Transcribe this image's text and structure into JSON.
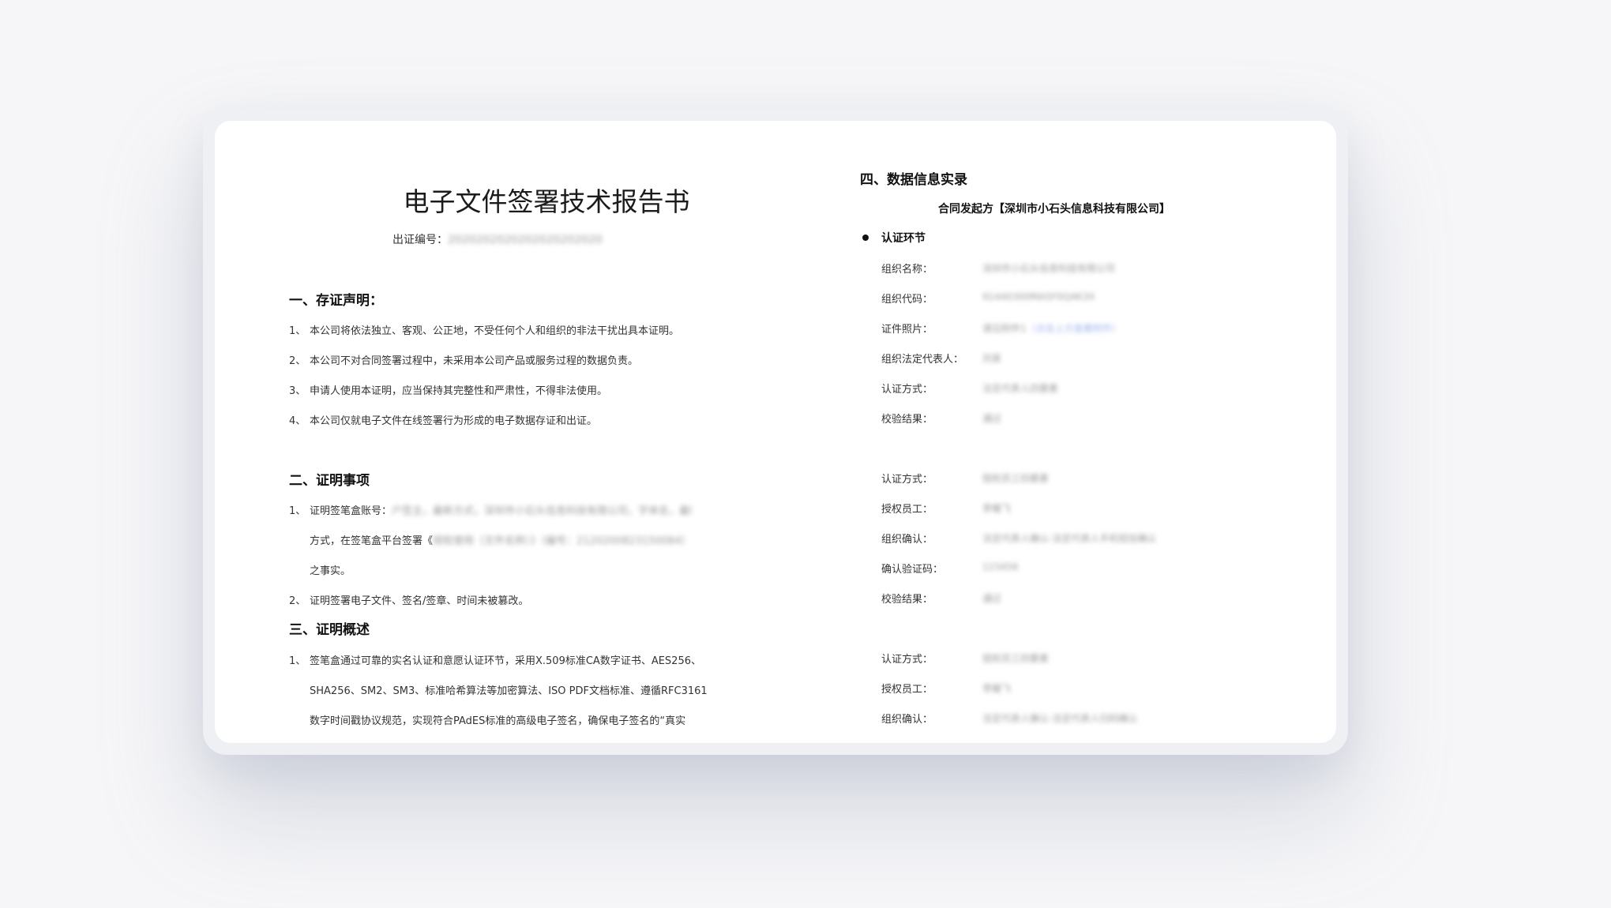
{
  "left": {
    "title": "电子文件签署技术报告书",
    "cert_no_label": "出证编号：",
    "cert_no_value": "2020202020202020202020",
    "section1": {
      "title": "一、存证声明：",
      "items": [
        {
          "num": "1、",
          "text": "本公司将依法独立、客观、公正地，不受任何个人和组织的非法干扰出具本证明。"
        },
        {
          "num": "2、",
          "text": "本公司不对合同签署过程中，未采用本公司产品或服务过程的数据负责。"
        },
        {
          "num": "3、",
          "text": "申请人使用本证明，应当保持其完整性和严肃性，不得非法使用。"
        },
        {
          "num": "4、",
          "text": "本公司仅就电子文件在线签署行为形成的电子数据存证和出证。"
        }
      ]
    },
    "section2": {
      "title": "二、证明事项",
      "item1_num": "1、",
      "item1_prefix": "证明签笔盒账号：",
      "item1_blur": "户签主，最新方式，深圳市小石头信息科技有限公司，字体名，最新",
      "item1_line2_prefix": "方式，在签笔盒平台签署《",
      "item1_line2_blur": "授权使用（文件名称）》（编号：2120200823150084）",
      "item1_line3": "之事实。",
      "item2_num": "2、",
      "item2_text": "证明签署电子文件、签名/签章、时间未被篡改。"
    },
    "section3": {
      "title": "三、证明概述",
      "item1_num": "1、",
      "lines": [
        "签笔盒通过可靠的实名认证和意愿认证环节，采用X.509标准CA数字证书、AES256、",
        "SHA256、SM2、SM3、标准哈希算法等加密算法、ISO PDF文档标准、遵循RFC3161",
        "数字时间戳协议规范，实现符合PAdES标准的高级电子签名，确保电子签名的“真实"
      ]
    }
  },
  "right": {
    "title": "四、数据信息实录",
    "party_title": "合同发起方【深圳市小石头信息科技有限公司】",
    "auth_title": "认证环节",
    "group1": [
      {
        "label": "组织名称：",
        "value": "深圳市小石头信息科技有限公司"
      },
      {
        "label": "组织代码：",
        "value": "91440300MA5F0Q4K3X"
      },
      {
        "label": "证件照片：",
        "value": "请见附件1",
        "link": "（点击上方查看附件）"
      },
      {
        "label": "组织法定代表人：",
        "value": "刘某"
      },
      {
        "label": "认证方式：",
        "value": "法定代表人四要素"
      },
      {
        "label": "校验结果：",
        "value": "通过"
      }
    ],
    "group2": [
      {
        "label": "认证方式：",
        "value": "授权员工四要素"
      },
      {
        "label": "授权员工：",
        "value": "李耀飞"
      },
      {
        "label": "组织确认：",
        "value": "法定代表人确认-法定代表人手机短信确认"
      },
      {
        "label": "确认验证码：",
        "value": "123456"
      },
      {
        "label": "校验结果：",
        "value": "通过"
      }
    ],
    "group3": [
      {
        "label": "认证方式：",
        "value": "授权员工四要素"
      },
      {
        "label": "授权员工：",
        "value": "李耀飞"
      },
      {
        "label": "组织确认：",
        "value": "法定代表人确认-法定代表人扫码确认"
      }
    ]
  }
}
